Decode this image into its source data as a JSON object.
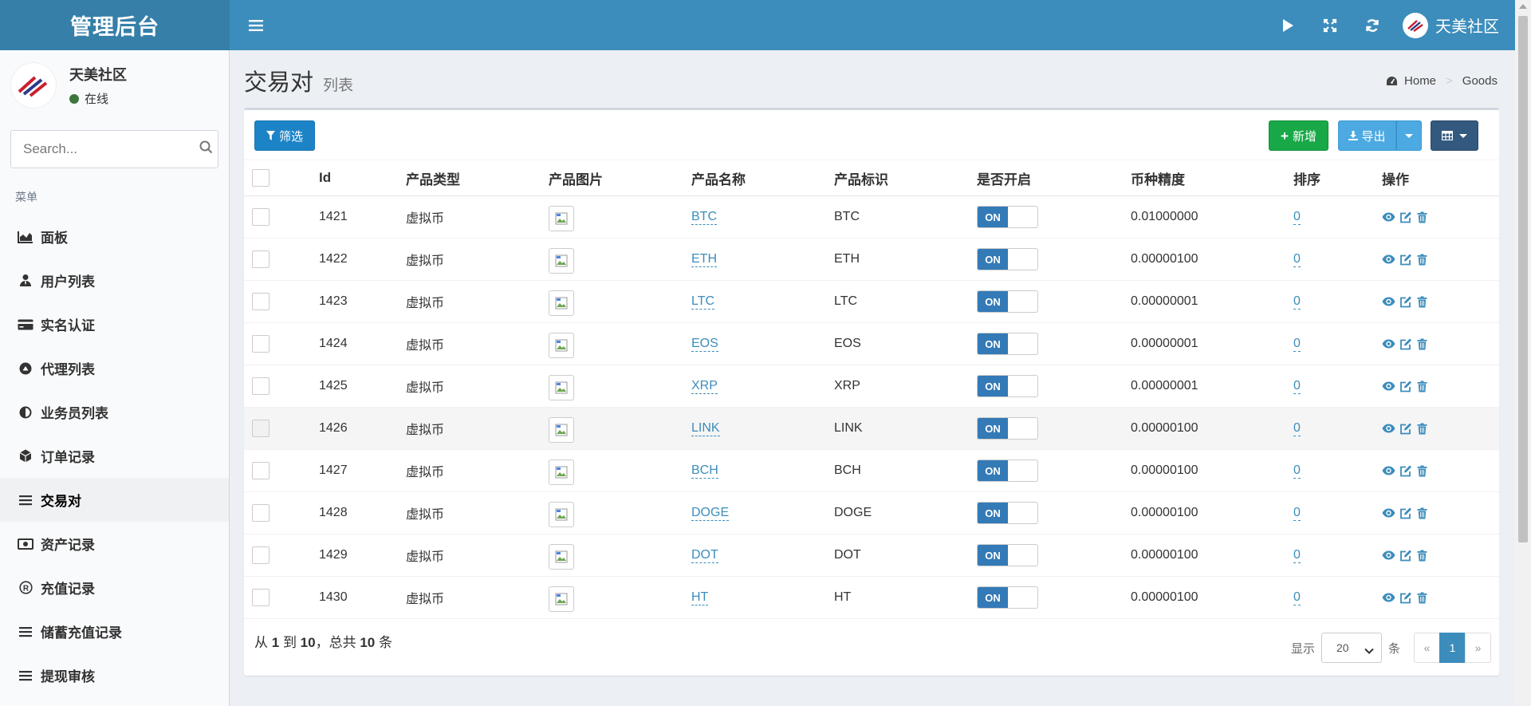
{
  "app": {
    "logo": "管理后台",
    "user_name": "天美社区",
    "user_status": "在线"
  },
  "sidebar": {
    "search_placeholder": "Search...",
    "menu_header": "菜单",
    "items": [
      {
        "label": "面板",
        "icon": "area-chart-icon"
      },
      {
        "label": "用户列表",
        "icon": "user-tie-icon"
      },
      {
        "label": "实名认证",
        "icon": "credit-card-icon"
      },
      {
        "label": "代理列表",
        "icon": "up-circle-icon"
      },
      {
        "label": "业务员列表",
        "icon": "half-circle-icon"
      },
      {
        "label": "订单记录",
        "icon": "cube-icon"
      },
      {
        "label": "交易对",
        "icon": "bars-icon",
        "active": true
      },
      {
        "label": "资产记录",
        "icon": "money-bill-icon"
      },
      {
        "label": "充值记录",
        "icon": "registered-icon"
      },
      {
        "label": "储蓄充值记录",
        "icon": "bars-icon"
      },
      {
        "label": "提现审核",
        "icon": "bars-icon"
      }
    ]
  },
  "page": {
    "title": "交易对",
    "subtitle": "列表"
  },
  "breadcrumb": {
    "home": "Home",
    "current": "Goods"
  },
  "toolbar": {
    "filter": "筛选",
    "add": "新增",
    "export": "导出"
  },
  "table": {
    "headers": {
      "id": "Id",
      "type": "产品类型",
      "image": "产品图片",
      "name": "产品名称",
      "symbol": "产品标识",
      "enabled": "是否开启",
      "precision": "币种精度",
      "sort": "排序",
      "actions": "操作"
    },
    "toggle_label": "ON",
    "rows": [
      {
        "id": "1421",
        "type": "虚拟币",
        "name": "BTC",
        "symbol": "BTC",
        "precision": "0.01000000",
        "sort": "0"
      },
      {
        "id": "1422",
        "type": "虚拟币",
        "name": "ETH",
        "symbol": "ETH",
        "precision": "0.00000100",
        "sort": "0"
      },
      {
        "id": "1423",
        "type": "虚拟币",
        "name": "LTC",
        "symbol": "LTC",
        "precision": "0.00000001",
        "sort": "0"
      },
      {
        "id": "1424",
        "type": "虚拟币",
        "name": "EOS",
        "symbol": "EOS",
        "precision": "0.00000001",
        "sort": "0"
      },
      {
        "id": "1425",
        "type": "虚拟币",
        "name": "XRP",
        "symbol": "XRP",
        "precision": "0.00000001",
        "sort": "0"
      },
      {
        "id": "1426",
        "type": "虚拟币",
        "name": "LINK",
        "symbol": "LINK",
        "precision": "0.00000100",
        "sort": "0"
      },
      {
        "id": "1427",
        "type": "虚拟币",
        "name": "BCH",
        "symbol": "BCH",
        "precision": "0.00000100",
        "sort": "0"
      },
      {
        "id": "1428",
        "type": "虚拟币",
        "name": "DOGE",
        "symbol": "DOGE",
        "precision": "0.00000100",
        "sort": "0"
      },
      {
        "id": "1429",
        "type": "虚拟币",
        "name": "DOT",
        "symbol": "DOT",
        "precision": "0.00000100",
        "sort": "0"
      },
      {
        "id": "1430",
        "type": "虚拟币",
        "name": "HT",
        "symbol": "HT",
        "precision": "0.00000100",
        "sort": "0"
      }
    ]
  },
  "pagination": {
    "from_prefix": "从",
    "from": "1",
    "to_word": "到",
    "to": "10",
    "total_prefix": "，总共",
    "total": "10",
    "unit": "条",
    "show_label": "显示",
    "page_size": "20",
    "per_unit": "条",
    "prev": "«",
    "current": "1",
    "next": "»"
  },
  "colors": {
    "header": "#3c8dbc",
    "logo_bg": "#367fa9",
    "toggle_on": "#337ab7",
    "add_btn": "#18a848"
  }
}
